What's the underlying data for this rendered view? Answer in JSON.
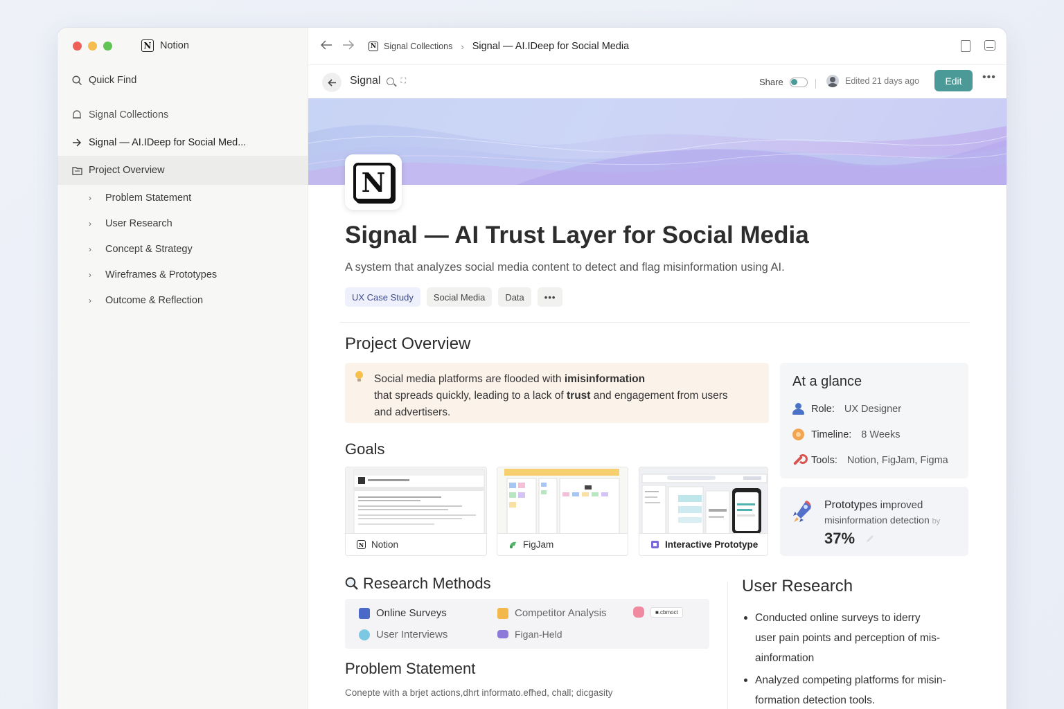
{
  "app": {
    "name": "Notion"
  },
  "sidebar": {
    "quick_find": "Quick Find",
    "collections": "Signal Collections",
    "current_page": "Signal — AI.IDeep for Social Med...",
    "active": "Project Overview",
    "sections": [
      "Problem Statement",
      "User Research",
      "Concept & Strategy",
      "Wireframes & Prototypes",
      "Outcome & Reflection"
    ]
  },
  "topbar": {
    "breadcrumb_parent": "Signal Collections",
    "breadcrumb_current": "Signal — AI.IDeep for Social Media"
  },
  "pagebar": {
    "page_name": "Signal",
    "share_label": "Share",
    "edited": "Edited 21 days ago",
    "edit_label": "Edit",
    "more": "•••"
  },
  "page": {
    "title": "Signal — AI Trust Layer for Social Media",
    "subtitle": "A system that analyzes social media content to detect and flag misinformation using AI.",
    "tags": [
      "UX Case Study",
      "Social Media",
      "Data"
    ],
    "tags_more": "•••"
  },
  "overview": {
    "heading": "Project Overview",
    "callout_p1": "Social media platforms",
    "callout_p2": " are flooded with ",
    "callout_p3": "imisinformation",
    "callout_p4": "that spreads ",
    "callout_p5": "quickly",
    "callout_p6": ", leading to a lack of ",
    "callout_p7": "trust",
    "callout_p8": " and engagement from users",
    "callout_p9": "and advertisers."
  },
  "glance": {
    "title": "At a glance",
    "role_label": "Role:",
    "role_value": "UX Designer",
    "timeline_label": "Timeline:",
    "timeline_value": "8 Weeks",
    "tools_label": "Tools:",
    "tools_value": "Notion, FigJam, Figma"
  },
  "stat": {
    "line1_bold": "Prototypes",
    "line1_rest": " improved",
    "line2": "misinformation detection",
    "line2_tail": "by",
    "value": "37%"
  },
  "goals": {
    "heading": "Goals",
    "cards": [
      "Notion",
      "FigJam",
      "Interactive Prototype"
    ]
  },
  "research_methods": {
    "heading": "Research Methods",
    "items": [
      "Online Surveys",
      "Competitor Analysis",
      "User Interviews",
      "Figan-Held"
    ],
    "extra_chip": "■.cbmoct"
  },
  "problem": {
    "heading": "Problem Statement",
    "text": "Conepte with a brjet actions,dhrt informato.efħed, chall; dicgasity"
  },
  "user_research": {
    "heading": "User Research",
    "bullet1_a": "Conducted online surveys to iderry",
    "bullet1_b": "user pain points and perception of mis-",
    "bullet1_c": "ainformation",
    "bullet2_a": "Analyzed competing platforms for misin-",
    "bullet2_b": "formation detection tools."
  },
  "colors": {
    "accent": "#4c9a98",
    "callout": "#fbf3ea",
    "cover_start": "#b9c7f0",
    "cover_end": "#c0b3ef"
  }
}
